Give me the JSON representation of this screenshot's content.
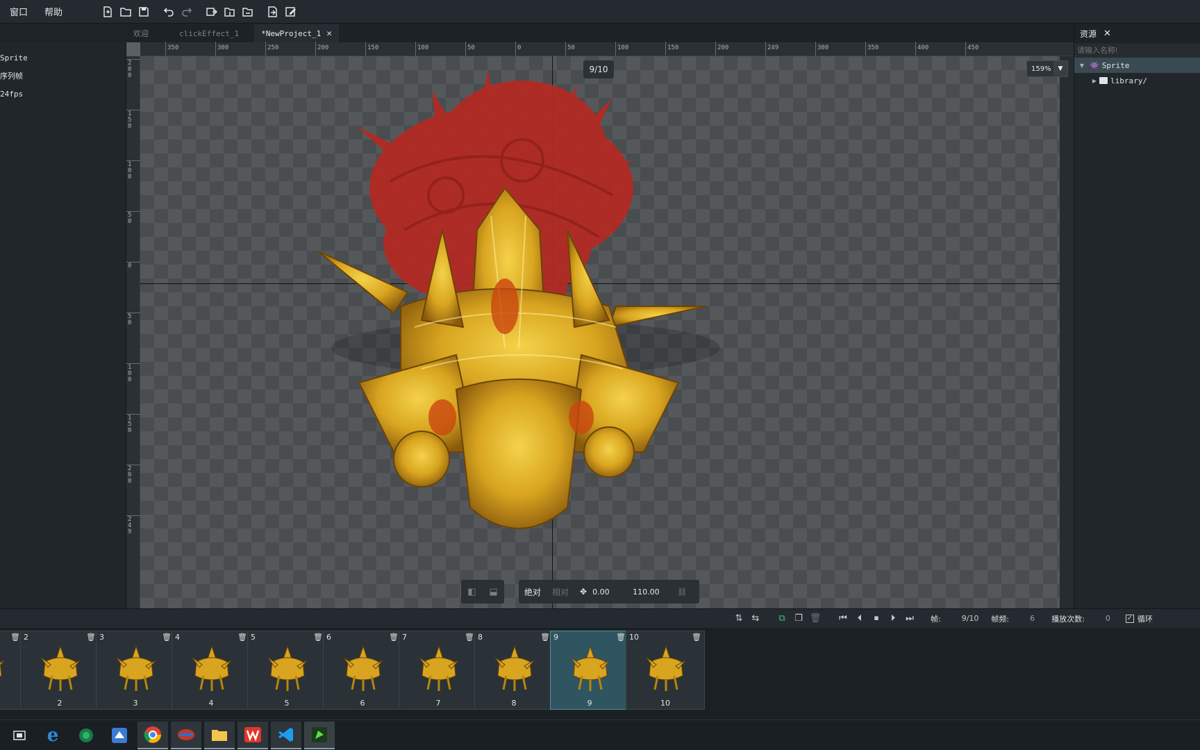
{
  "menubar": {
    "items": [
      "窗口",
      "帮助"
    ]
  },
  "tabs": [
    {
      "label": "欢迎",
      "active": false
    },
    {
      "label": "clickEffect_1",
      "active": false
    },
    {
      "label": "*NewProject_1",
      "active": true
    }
  ],
  "left_panel": {
    "lines": [
      "Sprite",
      "序列帧",
      "24fps"
    ]
  },
  "ruler_top": [
    "350",
    "300",
    "250",
    "200",
    "150",
    "100",
    "50",
    "0",
    "50",
    "100",
    "150",
    "200",
    "249",
    "300",
    "350",
    "400",
    "450"
  ],
  "ruler_left": [
    "200",
    "150",
    "100",
    "50",
    "0",
    "50",
    "100",
    "150",
    "200",
    "249"
  ],
  "stage": {
    "frame_counter": "9/10",
    "zoom": "159%"
  },
  "transform": {
    "mode_absolute": "绝对",
    "mode_relative": "相对",
    "x": "0.00",
    "y": "110.00"
  },
  "resources": {
    "title": "资源",
    "search_placeholder": "请输入名称!",
    "tree": [
      {
        "label": "Sprite",
        "selected": true
      },
      {
        "label": "library/",
        "selected": false
      }
    ]
  },
  "timeline": {
    "frame_label": "帧:",
    "frame_value": "9/10",
    "fps_label": "帧频:",
    "fps_value": "6",
    "play_count_label": "播放次数:",
    "play_count_value": "0",
    "loop_label": "循环",
    "loop_checked": true
  },
  "frames": [
    {
      "num": "",
      "caption": ""
    },
    {
      "num": "2",
      "caption": "2"
    },
    {
      "num": "3",
      "caption": "3"
    },
    {
      "num": "4",
      "caption": "4"
    },
    {
      "num": "5",
      "caption": "5"
    },
    {
      "num": "6",
      "caption": "6"
    },
    {
      "num": "7",
      "caption": "7"
    },
    {
      "num": "8",
      "caption": "8"
    },
    {
      "num": "9",
      "caption": "9"
    },
    {
      "num": "10",
      "caption": "10"
    }
  ],
  "selected_frame": "9",
  "colors": {
    "accent": "#2f5560",
    "gold": "#d9a520",
    "red": "#b52a22"
  },
  "taskbar": [
    "task-view-icon",
    "ie-icon",
    "app-green-icon",
    "app-blue-bird-icon",
    "chrome-icon",
    "app-red-icon",
    "explorer-icon",
    "wps-icon",
    "vscode-icon",
    "editor-app-icon"
  ]
}
